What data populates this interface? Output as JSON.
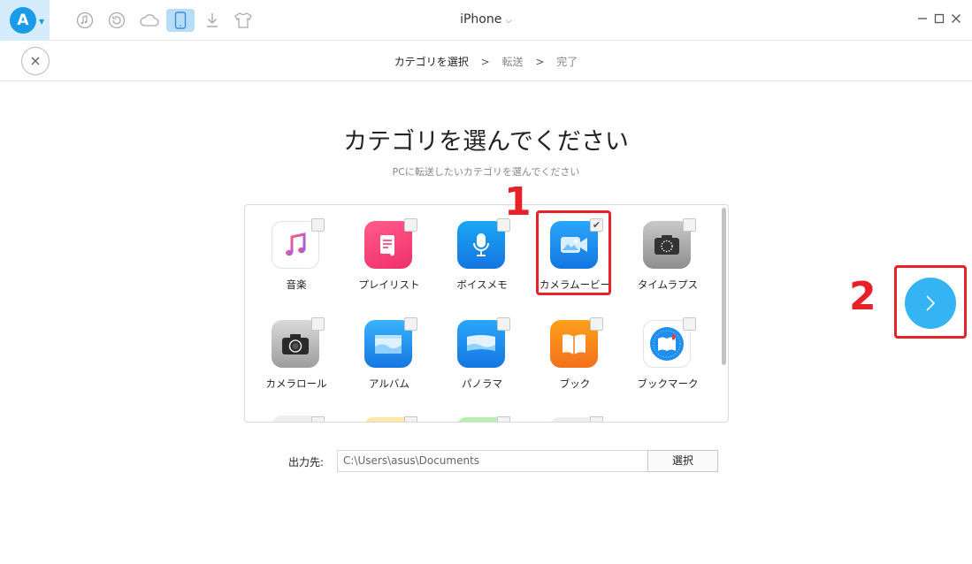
{
  "app": {
    "title": "iPhone"
  },
  "steps": {
    "current": "カテゴリを選択",
    "sep1": ">",
    "step2": "転送",
    "sep2": ">",
    "step3": "完了"
  },
  "heading": "カテゴリを選んでください",
  "subheading": "PCに転送したいカテゴリを選んでください",
  "categories": [
    {
      "label": "音楽",
      "icon": "music-icon",
      "checked": false
    },
    {
      "label": "プレイリスト",
      "icon": "playlist-icon",
      "checked": false
    },
    {
      "label": "ボイスメモ",
      "icon": "voice-memo-icon",
      "checked": false
    },
    {
      "label": "カメラムービー",
      "icon": "camera-movie-icon",
      "checked": true,
      "check_mark": "✔"
    },
    {
      "label": "タイムラプス",
      "icon": "timelapse-icon",
      "checked": false
    },
    {
      "label": "カメラロール",
      "icon": "camera-roll-icon",
      "checked": false
    },
    {
      "label": "アルバム",
      "icon": "album-icon",
      "checked": false
    },
    {
      "label": "パノラマ",
      "icon": "panorama-icon",
      "checked": false
    },
    {
      "label": "ブック",
      "icon": "book-icon",
      "checked": false
    },
    {
      "label": "ブックマーク",
      "icon": "bookmark-icon",
      "checked": false
    }
  ],
  "annotations": {
    "one": "1",
    "two": "2",
    "color": "#e8202a"
  },
  "output": {
    "label": "出力先:",
    "path": "C:\\Users\\asus\\Documents",
    "button": "選択"
  },
  "colors": {
    "accent": "#34b4f2",
    "active_tool": "#b7dcf6"
  }
}
